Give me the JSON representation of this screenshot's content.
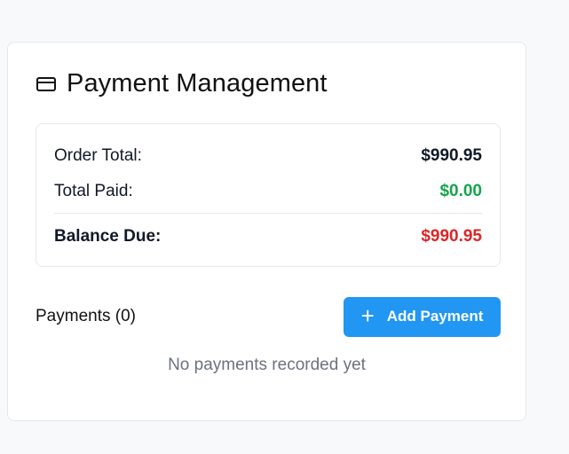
{
  "panel": {
    "title": "Payment Management",
    "icon": "credit-card-icon"
  },
  "summary": {
    "order_total_label": "Order Total:",
    "order_total_value": "$990.95",
    "total_paid_label": "Total Paid:",
    "total_paid_value": "$0.00",
    "balance_due_label": "Balance Due:",
    "balance_due_value": "$990.95"
  },
  "payments": {
    "title": "Payments (0)",
    "add_button_label": "Add Payment",
    "add_button_icon": "plus-icon",
    "empty_message": "No payments recorded yet"
  },
  "colors": {
    "accent": "#2196f3",
    "paid": "#16a34a",
    "due": "#dc2626"
  }
}
